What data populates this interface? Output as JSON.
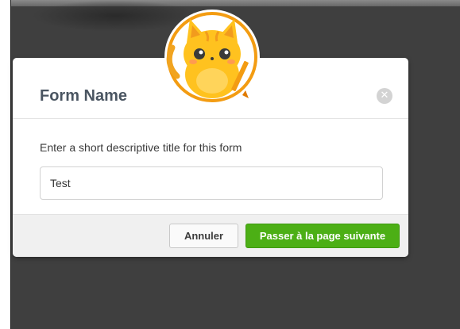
{
  "modal": {
    "title": "Form Name",
    "close_icon": "close-icon",
    "instructions": "Enter a short descriptive title for this form",
    "input_value": "Test",
    "cancel_label": "Annuler",
    "next_label": "Passer à la page suivante"
  },
  "mascot": {
    "icon": "cat-mascot-icon"
  },
  "colors": {
    "overlay": "#3f3f3f",
    "primary_button": "#4caf15",
    "title": "#4a5561",
    "mascot_ring": "#f39c12"
  }
}
